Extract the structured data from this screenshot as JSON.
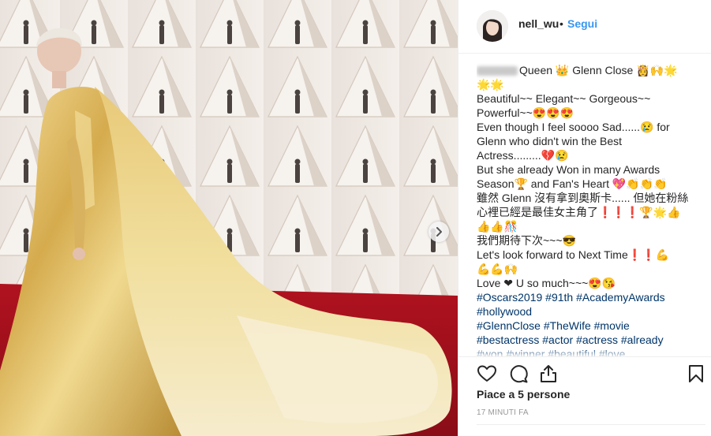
{
  "photo": {
    "alt": "Red carpet photo of a woman in a gold cape gown"
  },
  "post": {
    "username": "nell_wu",
    "separator": "•",
    "follow_label": "Segui",
    "caption_lines": [
      "Queen 👑 Glenn Close 👸🙌🌟",
      "🌟🌟",
      "Beautiful~~ Elegant~~ Gorgeous~~",
      "Powerful~~😍😍😍",
      "Even though I feel soooo Sad......😢 for",
      "Glenn who didn't win the Best",
      "Actress.........💔😢",
      "But she already Won in many Awards",
      "Season🏆 and Fan's Heart 💖👏👏👏",
      "雖然 Glenn 沒有拿到奧斯卡...... 但她在粉絲",
      "心裡已經是最佳女主角了❗❗❗🏆🌟👍",
      "👍👍🎊",
      "我們期待下次~~~😎",
      "Let's look forward to Next Time❗❗💪",
      "💪💪🙌",
      "Love ❤ U so much~~~😍😘"
    ],
    "hashtag_lines": [
      "#Oscars2019 #91th #AcademyAwards",
      "#hollywood",
      "#GlennClose #TheWife #movie",
      "#bestactress #actor #actress #already",
      "#won #winner #beautiful #love"
    ],
    "likes_text": "Piace a 5 persone",
    "timestamp": "17 MINUTI FA"
  },
  "icons": {
    "like": "heart-icon",
    "comment": "comment-icon",
    "share": "share-icon",
    "save": "bookmark-icon",
    "next": "chevron-right-icon"
  },
  "colors": {
    "link": "#003569",
    "follow": "#3897f0",
    "text": "#262626",
    "muted": "#999999",
    "carpet": "#a3101e",
    "gown": "#d9b45a"
  }
}
